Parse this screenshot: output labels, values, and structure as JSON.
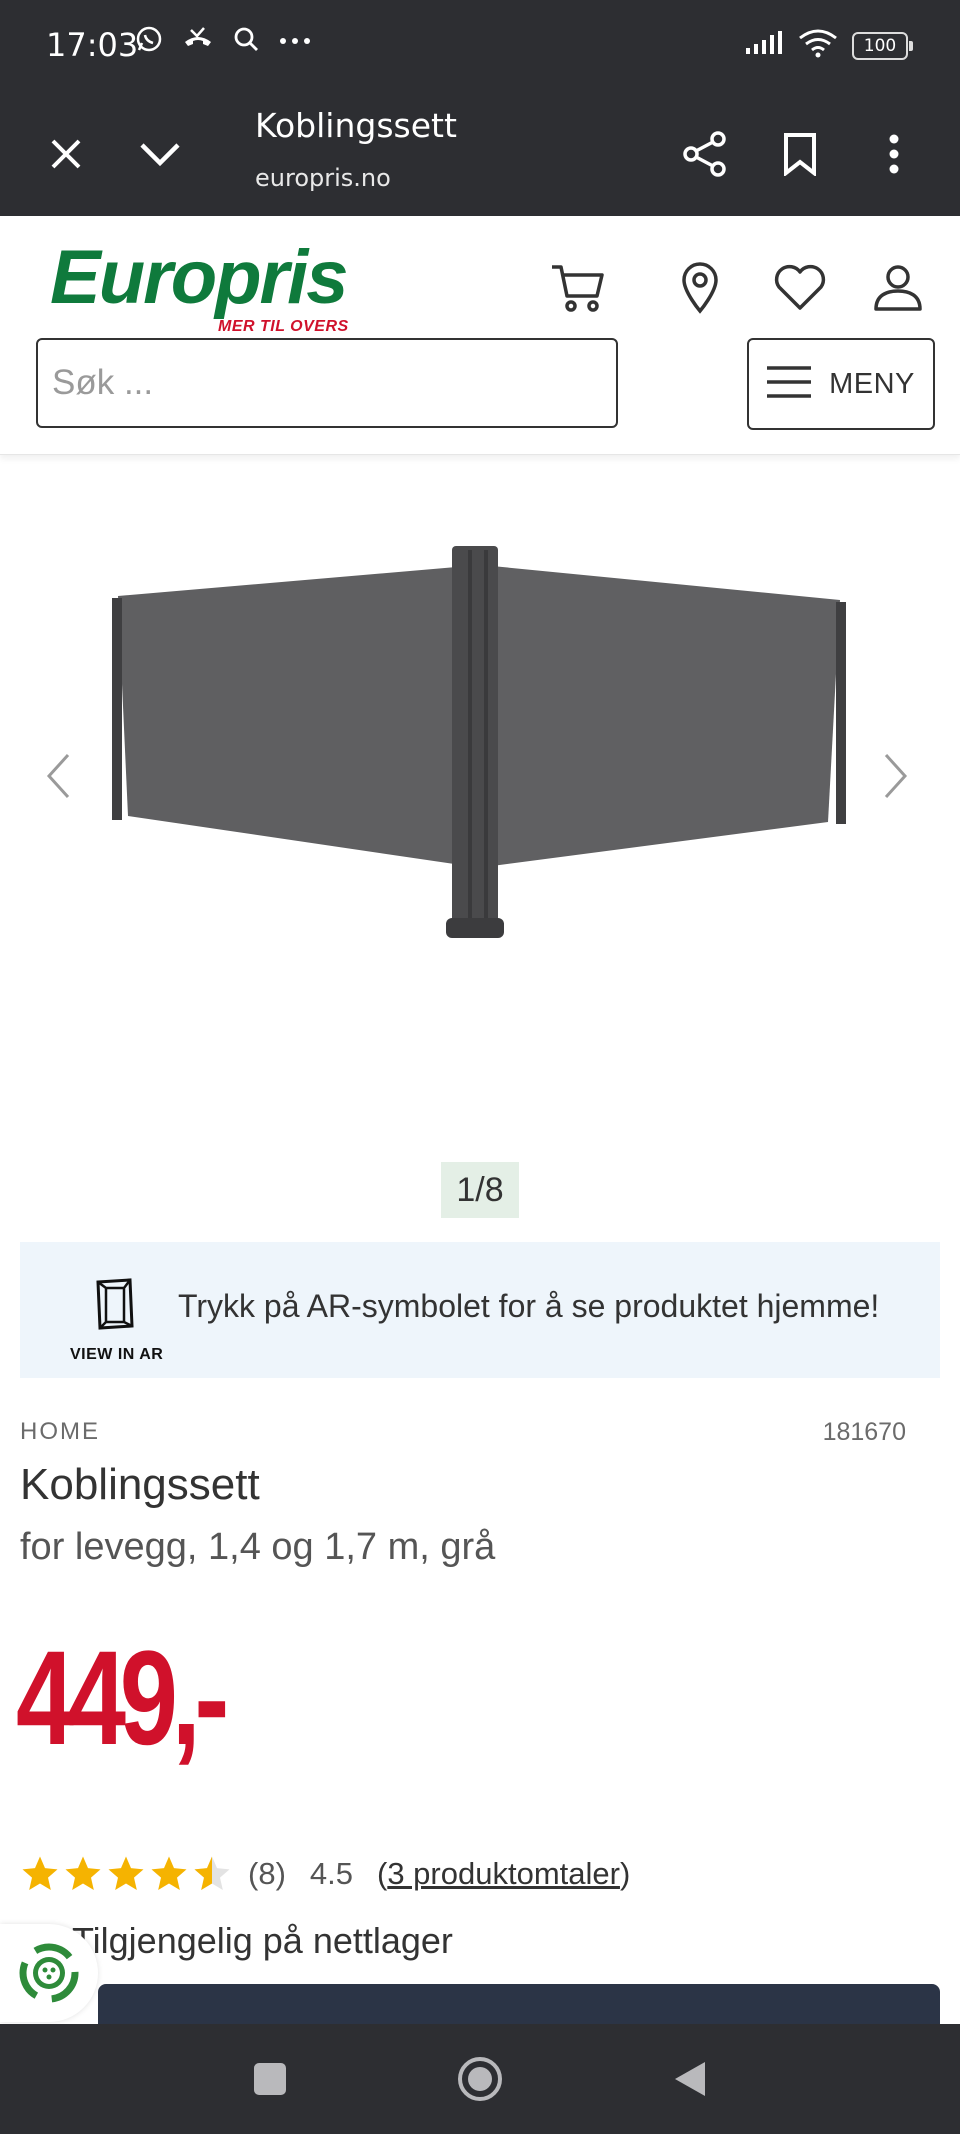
{
  "statusbar": {
    "time": "17:03",
    "icons": [
      "whatsapp-icon",
      "missed-call-icon",
      "search-icon",
      "more-dots-icon"
    ],
    "battery": "100"
  },
  "browser": {
    "title": "Koblingssett",
    "url": "europris.no",
    "buttons": [
      "close-icon",
      "chevron-down-icon",
      "share-icon",
      "bookmark-icon",
      "overflow-menu-icon"
    ]
  },
  "header": {
    "logo_text": "Europris",
    "logo_tagline": "MER TIL OVERS",
    "icons": [
      "cart-icon",
      "location-pin-icon",
      "heart-icon",
      "user-icon"
    ],
    "search_placeholder": "Søk ...",
    "menu_label": "MENY"
  },
  "gallery": {
    "counter": "1/8"
  },
  "ar_banner": {
    "label": "VIEW IN AR",
    "text": "Trykk på AR-symbolet for å se produktet hjemme!"
  },
  "product": {
    "category": "HOME",
    "sku": "181670",
    "title": "Koblingssett",
    "subtitle": "for levegg, 1,4 og 1,7 m, grå",
    "price": "449,-",
    "rating_value": 4.5,
    "rating_count": "(8)",
    "rating_avg": "4.5",
    "reviews_open": "(",
    "reviews_link": "3 produktomtaler",
    "reviews_close": ")",
    "availability": "Tilgjengelig på nettlager"
  },
  "colors": {
    "brand_green": "#0f7a3c",
    "price_red": "#d0112b",
    "star_yellow": "#f5b301",
    "dark_bar": "#2d2e32"
  }
}
